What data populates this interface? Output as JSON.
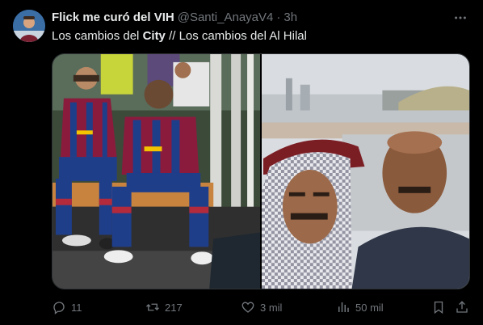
{
  "author": {
    "display_name": "Flick me curó del VIH",
    "handle": "@Santi_AnayaV4",
    "separator": "·",
    "time": "3h"
  },
  "tweet": {
    "text_part1": "Los cambios del ",
    "text_bold1": "City",
    "text_part2": " // Los cambios del Al Hilal"
  },
  "media": {
    "left_image": "footballers-on-bench-photo",
    "right_image": "selfie-two-men-photo"
  },
  "actions": {
    "replies": "11",
    "retweets": "217",
    "likes": "3 mil",
    "views": "50 mil"
  },
  "icons": {
    "more": "more-icon",
    "reply": "reply-icon",
    "retweet": "retweet-icon",
    "like": "heart-icon",
    "views": "views-icon",
    "bookmark": "bookmark-icon",
    "share": "share-icon"
  },
  "colors": {
    "background": "#000000",
    "text_primary": "#e7e9ea",
    "text_secondary": "#71767b",
    "border": "#2f3336"
  }
}
